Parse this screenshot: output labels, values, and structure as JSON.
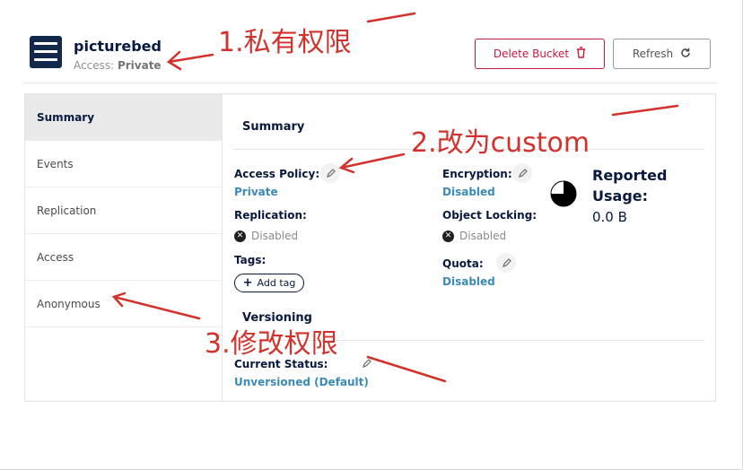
{
  "bucket": {
    "name": "picturebed",
    "access_label": "Access:",
    "access_value": "Private"
  },
  "toolbar": {
    "delete_label": "Delete Bucket",
    "refresh_label": "Refresh"
  },
  "sidebar": {
    "items": [
      {
        "label": "Summary",
        "active": true
      },
      {
        "label": "Events"
      },
      {
        "label": "Replication"
      },
      {
        "label": "Access"
      },
      {
        "label": "Anonymous"
      }
    ]
  },
  "summary": {
    "title": "Summary",
    "access_policy": {
      "label": "Access Policy:",
      "value": "Private"
    },
    "replication": {
      "label": "Replication:",
      "value": "Disabled"
    },
    "tags": {
      "label": "Tags:",
      "add_label": "Add tag"
    },
    "encryption": {
      "label": "Encryption:",
      "value": "Disabled"
    },
    "object_locking": {
      "label": "Object Locking:",
      "value": "Disabled"
    },
    "quota": {
      "label": "Quota:",
      "value": "Disabled"
    },
    "usage": {
      "title_line1": "Reported",
      "title_line2": "Usage:",
      "value": "0.0 B",
      "fraction": 0.75
    }
  },
  "versioning": {
    "title": "Versioning",
    "status_label": "Current Status:",
    "status_value": "Unversioned (Default)"
  },
  "annotations": {
    "note1": "1.私有权限",
    "note2": "2.改为custom",
    "note3": "3.修改权限",
    "color": "#d3312b"
  },
  "colors": {
    "accent_link": "#3a8ab8",
    "danger": "#c51b3f",
    "navy": "#07193e"
  }
}
